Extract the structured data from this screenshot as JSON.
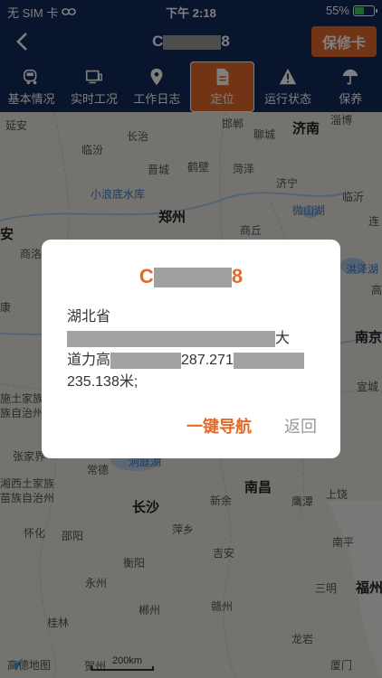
{
  "status": {
    "carrier": "无 SIM 卡",
    "time": "下午 2:18",
    "battery": "55%",
    "battery_level": 0.55
  },
  "nav": {
    "title_start": "C",
    "title_end": "8",
    "repair_label": "保修卡"
  },
  "tabs": [
    {
      "label": "基本情况",
      "icon": "truck-icon"
    },
    {
      "label": "实时工况",
      "icon": "monitor-icon"
    },
    {
      "label": "工作日志",
      "icon": "location-pin-icon"
    },
    {
      "label": "定位",
      "icon": "document-icon"
    },
    {
      "label": "运行状态",
      "icon": "warning-icon"
    },
    {
      "label": "保养",
      "icon": "umbrella-icon"
    }
  ],
  "map": {
    "places": [
      "延安",
      "邯郸",
      "淄博",
      "临汾",
      "长治",
      "聊城",
      "济南",
      "晋城",
      "鹤壁",
      "菏泽",
      "小浪底水库",
      "济宁",
      "临沂",
      "郑州",
      "微山湖",
      "连",
      "安",
      "商洛",
      "商丘",
      "洪泽湖",
      "高",
      "康",
      "南京",
      "宣城",
      "施土家族",
      "族自治州",
      "张家界",
      "常德",
      "洞庭湖",
      "湘西土家族",
      "苗族自治州",
      "南昌",
      "鹰潭",
      "上饶",
      "怀化",
      "长沙",
      "新余",
      "邵阳",
      "萍乡",
      "南平",
      "衡阳",
      "吉安",
      "永州",
      "三明",
      "福州",
      "郴州",
      "赣州",
      "桂林",
      "龙岩",
      "贺州",
      "厦门"
    ],
    "logo": "高德地图",
    "scale": "200km"
  },
  "dialog": {
    "title_start": "C",
    "title_end": "8",
    "address_line1_start": "湖北省",
    "address_line1_end": "大",
    "address_line2_start": "道力高",
    "address_line2_mid": "287.271",
    "address_line3": "235.138米;",
    "navigate_label": "一键导航",
    "back_label": "返回"
  }
}
